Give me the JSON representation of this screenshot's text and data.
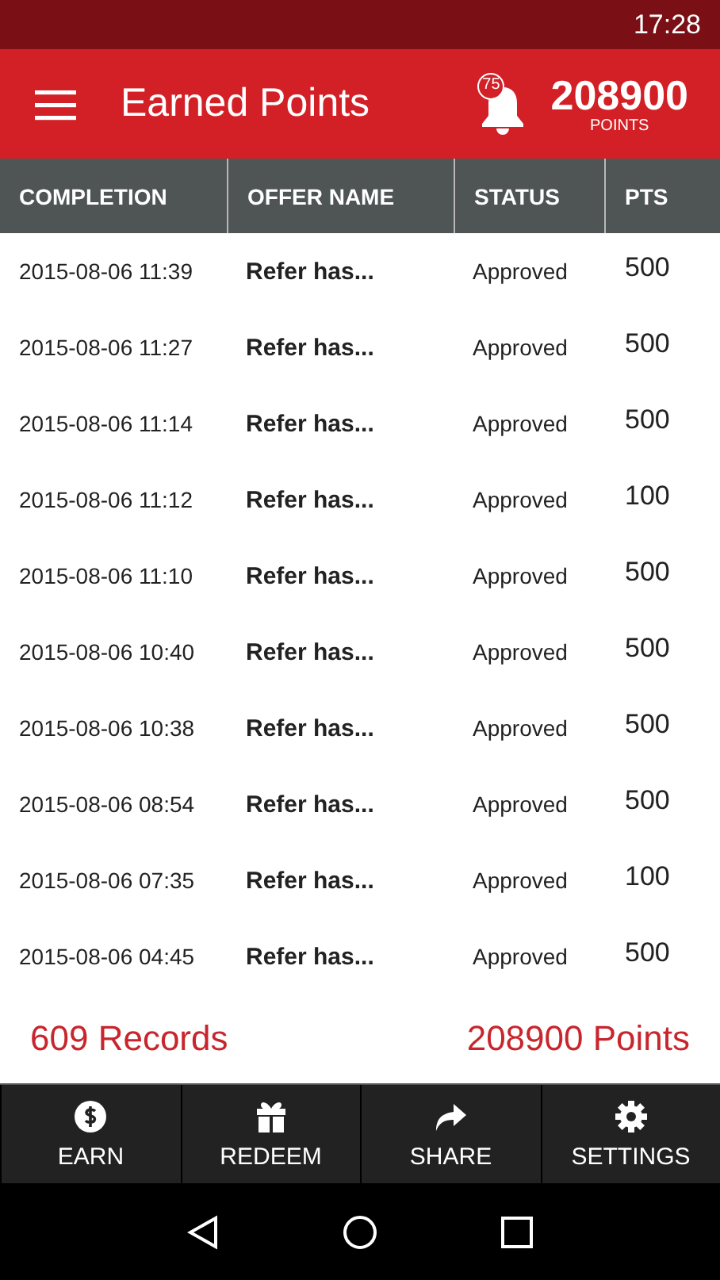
{
  "status_bar": {
    "time": "17:28"
  },
  "app_bar": {
    "title": "Earned Points",
    "notification_count": "75",
    "points": "208900",
    "points_label": "POINTS"
  },
  "table": {
    "columns": [
      "COMPLETION",
      "OFFER NAME",
      "STATUS",
      "PTS"
    ],
    "rows": [
      {
        "completion": "2015-08-06 11:39",
        "offer_name": "Refer has...",
        "status": "Approved",
        "pts": "500"
      },
      {
        "completion": "2015-08-06 11:27",
        "offer_name": "Refer has...",
        "status": "Approved",
        "pts": "500"
      },
      {
        "completion": "2015-08-06 11:14",
        "offer_name": "Refer has...",
        "status": "Approved",
        "pts": "500"
      },
      {
        "completion": "2015-08-06 11:12",
        "offer_name": "Refer has...",
        "status": "Approved",
        "pts": "100"
      },
      {
        "completion": "2015-08-06 11:10",
        "offer_name": "Refer has...",
        "status": "Approved",
        "pts": "500"
      },
      {
        "completion": "2015-08-06 10:40",
        "offer_name": "Refer has...",
        "status": "Approved",
        "pts": "500"
      },
      {
        "completion": "2015-08-06 10:38",
        "offer_name": "Refer has...",
        "status": "Approved",
        "pts": "500"
      },
      {
        "completion": "2015-08-06 08:54",
        "offer_name": "Refer has...",
        "status": "Approved",
        "pts": "500"
      },
      {
        "completion": "2015-08-06 07:35",
        "offer_name": "Refer has...",
        "status": "Approved",
        "pts": "100"
      },
      {
        "completion": "2015-08-06 04:45",
        "offer_name": "Refer has...",
        "status": "Approved",
        "pts": "500"
      }
    ]
  },
  "summary": {
    "records": "609 Records",
    "points": "208900 Points"
  },
  "bottom_tabs": [
    {
      "kind": "dollar",
      "label": "EARN"
    },
    {
      "kind": "gift",
      "label": "REDEEM"
    },
    {
      "kind": "share",
      "label": "SHARE"
    },
    {
      "kind": "gear",
      "label": "SETTINGS"
    }
  ]
}
